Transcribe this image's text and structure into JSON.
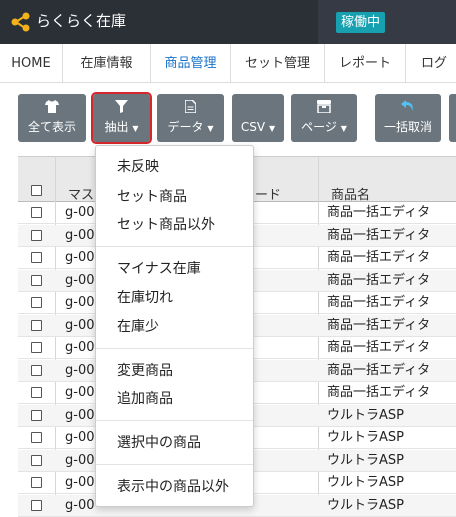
{
  "header": {
    "title": "らくらく在庫",
    "status": "稼働中"
  },
  "nav": {
    "items": [
      {
        "label": "HOME"
      },
      {
        "label": "在庫情報"
      },
      {
        "label": "商品管理",
        "active": true
      },
      {
        "label": "セット管理"
      },
      {
        "label": "レポート"
      },
      {
        "label": "ログ"
      }
    ]
  },
  "toolbar": {
    "show_all": "全て表示",
    "extract": "抽出",
    "data": "データ",
    "csv": "CSV",
    "page": "ページ",
    "undo_all": "一括取消"
  },
  "table": {
    "headers": {
      "master": "マス",
      "code": "ード",
      "product_name": "商品名"
    },
    "rows": [
      {
        "sku": "g-00",
        "name": "商品一括エディタ"
      },
      {
        "sku": "g-00",
        "name": "商品一括エディタ"
      },
      {
        "sku": "g-00",
        "name": "商品一括エディタ"
      },
      {
        "sku": "g-00",
        "name": "商品一括エディタ"
      },
      {
        "sku": "g-00",
        "name": "商品一括エディタ"
      },
      {
        "sku": "g-00",
        "name": "商品一括エディタ"
      },
      {
        "sku": "g-00",
        "name": "商品一括エディタ"
      },
      {
        "sku": "g-00",
        "name": "商品一括エディタ"
      },
      {
        "sku": "g-00",
        "name": "商品一括エディタ"
      },
      {
        "sku": "g-00",
        "name": "ウルトラASP"
      },
      {
        "sku": "g-00",
        "name": "ウルトラASP"
      },
      {
        "sku": "g-00",
        "name": "ウルトラASP"
      },
      {
        "sku": "g-00",
        "name": "ウルトラASP"
      },
      {
        "sku": "g-00",
        "name": "ウルトラASP"
      }
    ]
  },
  "dropdown": {
    "items": [
      "未反映",
      "セット商品",
      "セット商品以外",
      "マイナス在庫",
      "在庫切れ",
      "在庫少",
      "変更商品",
      "追加商品",
      "選択中の商品",
      "表示中の商品以外"
    ]
  },
  "colors": {
    "header_bg": "#2b2f36",
    "status_bg": "#17a0b0",
    "button_bg": "#6b757d",
    "active_nav": "#1a73c8",
    "highlight": "#d9262b"
  }
}
